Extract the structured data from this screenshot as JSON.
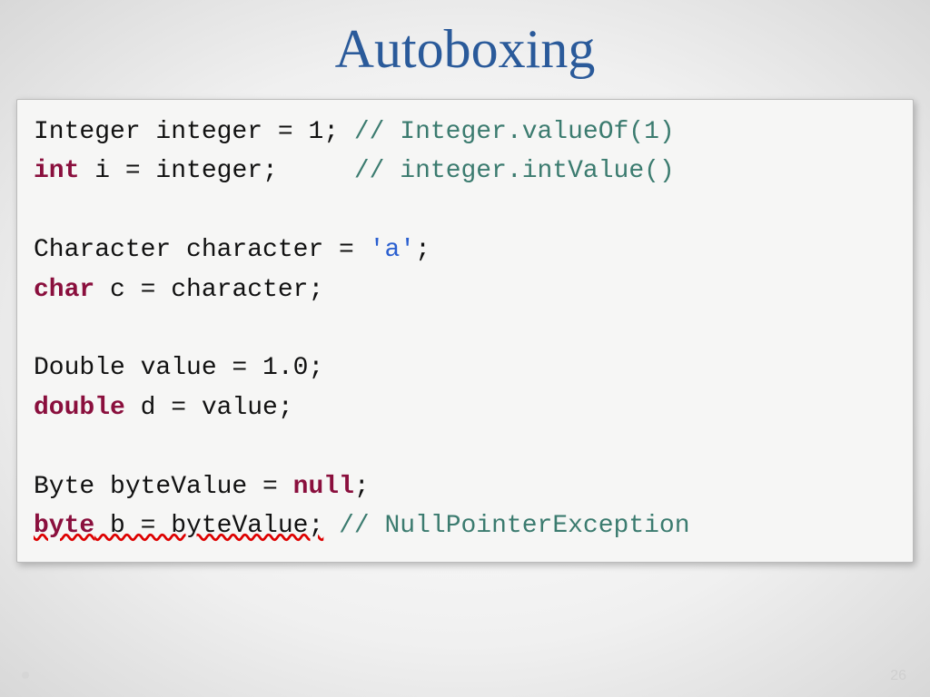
{
  "title": "Autoboxing",
  "code": {
    "l1_a": "Integer integer = 1; ",
    "l1_c": "// Integer.valueOf(1)",
    "l2_kw": "int",
    "l2_b": " i = integer;     ",
    "l2_c": "// integer.intValue()",
    "l3": "",
    "l4_a": "Character character = ",
    "l4_s": "'a'",
    "l4_b": ";",
    "l5_kw": "char",
    "l5_b": " c = character;",
    "l6": "",
    "l7": "Double value = 1.0;",
    "l8_kw": "double",
    "l8_b": " d = value;",
    "l9": "",
    "l10_a": "Byte byteValue = ",
    "l10_kw": "null",
    "l10_b": ";",
    "l11_kw": "byte",
    "l11_err": " b = byteValue;",
    "l11_sp": " ",
    "l11_c": "// NullPointerException"
  },
  "pageNumber": "26"
}
